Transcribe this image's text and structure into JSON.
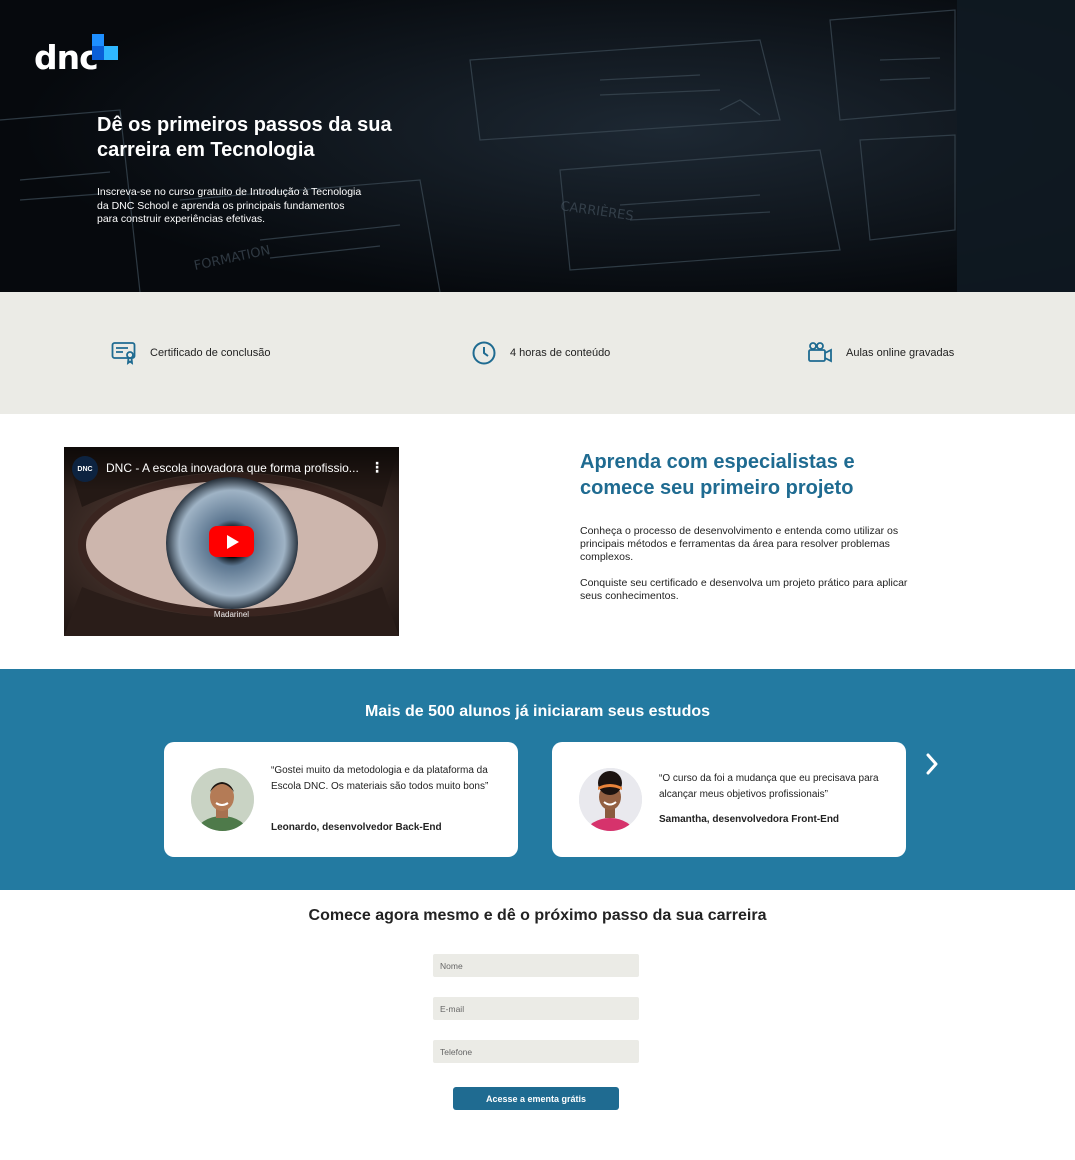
{
  "hero": {
    "logo_text": "dnc",
    "title": "Dê os primeiros passos da sua carreira em Tecnologia",
    "subtitle": "Inscreva-se no curso gratuito de Introdução à Tecnologia da DNC School e aprenda os principais fundamentos para construir experiências efetivas."
  },
  "features": [
    {
      "icon": "certificate-icon",
      "label": "Certificado de conclusão"
    },
    {
      "icon": "clock-icon",
      "label": "4 horas de conteúdo"
    },
    {
      "icon": "video-camera-icon",
      "label": "Aulas online gravadas"
    }
  ],
  "video": {
    "channel": "DNC",
    "title": "DNC - A escola inovadora que forma profissio...",
    "caption": "Madarinel"
  },
  "learn": {
    "title": "Aprenda com especialistas e comece seu primeiro projeto",
    "p1": "Conheça o processo de desenvolvimento e entenda como utilizar os principais métodos e ferramentas da área para resolver problemas complexos.",
    "p2": "Conquiste seu certificado e desenvolva um projeto prático para aplicar seus conhecimentos."
  },
  "testimonials": {
    "title": "Mais de 500 alunos já iniciaram seus estudos",
    "items": [
      {
        "quote": "“Gostei muito da metodologia e da plataforma da Escola DNC. Os materiais são todos muito bons”",
        "author": "Leonardo, desenvolvedor Back-End"
      },
      {
        "quote": "“O curso da foi a mudança que eu precisava para alcançar meus objetivos profissionais”",
        "author": "Samantha, desenvolvedora Front-End"
      }
    ]
  },
  "form": {
    "title": "Comece agora mesmo e dê o próximo passo da sua carreira",
    "name_placeholder": "Nome",
    "email_placeholder": "E-mail",
    "phone_placeholder": "Telefone",
    "submit_label": "Acesse a ementa grátis"
  },
  "colors": {
    "brand_blue": "#1f6b91",
    "testimonial_bg": "#237aa1",
    "feature_bg": "#ebebe6",
    "hero_bg": "#0a0e14"
  }
}
